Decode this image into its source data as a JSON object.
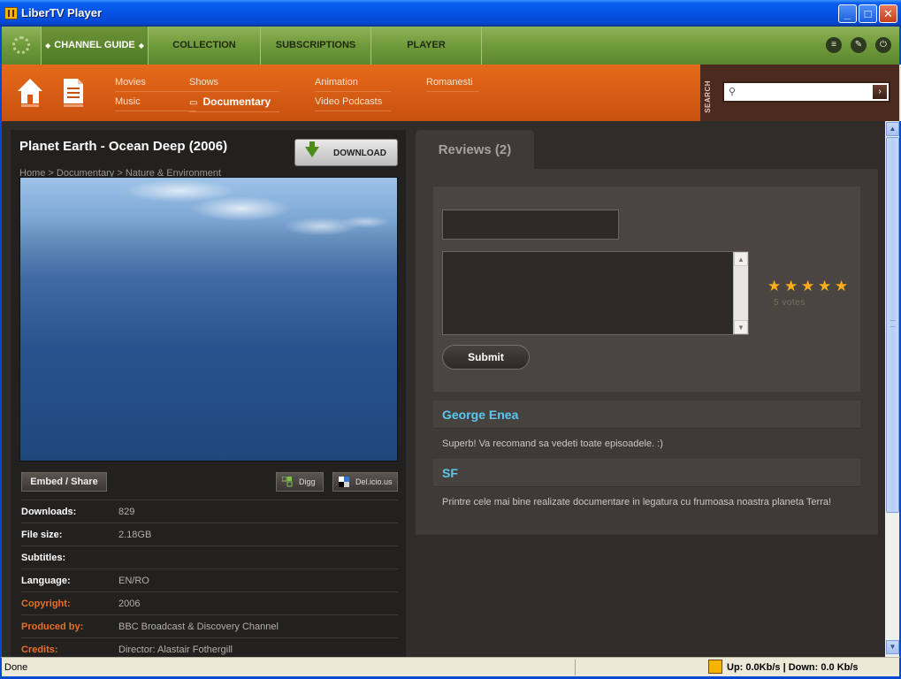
{
  "window": {
    "title": "LiberTV Player",
    "buttons": [
      "_",
      "□",
      "✕"
    ]
  },
  "nav": {
    "tabs": [
      {
        "label": "CHANNEL GUIDE",
        "active": true
      },
      {
        "label": "COLLECTION",
        "active": false
      },
      {
        "label": "SUBSCRIPTIONS",
        "active": false
      },
      {
        "label": "PLAYER",
        "active": false
      }
    ],
    "icons": [
      "list-icon",
      "wrench-icon",
      "power-icon"
    ]
  },
  "categories": [
    {
      "label": "Movies"
    },
    {
      "label": "Music"
    },
    {
      "label": "Shows"
    },
    {
      "label": "Documentary",
      "active": true
    },
    {
      "label": "Animation"
    },
    {
      "label": "Video Podcasts"
    },
    {
      "label": "Romanesti"
    }
  ],
  "search": {
    "label": "SEARCH",
    "placeholder": "",
    "go": "›"
  },
  "item": {
    "title": "Planet Earth - Ocean Deep (2006)",
    "breadcrumb": "Home > Documentary > Nature & Environment",
    "download_label": "DOWNLOAD",
    "embed_label": "Embed / Share",
    "digg_label": "Digg",
    "delicious_label": "Del.icio.us",
    "meta": [
      {
        "key": "Downloads:",
        "value": "829",
        "accent": false
      },
      {
        "key": "File size:",
        "value": "2.18GB",
        "accent": false
      },
      {
        "key": "Subtitles:",
        "value": "",
        "accent": false
      },
      {
        "key": "Language:",
        "value": "EN/RO",
        "accent": false
      },
      {
        "key": "Copyright:",
        "value": "2006",
        "accent": true
      },
      {
        "key": "Produced by:",
        "value": "BBC Broadcast & Discovery Channel",
        "accent": true
      },
      {
        "key": "Credits:",
        "value": "Director: Alastair Fothergill",
        "accent": true
      }
    ]
  },
  "reviews": {
    "tab_label": "Reviews (2)",
    "submit_label": "Submit",
    "rating": {
      "stars": 5,
      "max": 5,
      "votes_label": "5 votes"
    },
    "list": [
      {
        "author": "George Enea",
        "text": "Superb! Va recomand sa vedeti toate episoadele. :)"
      },
      {
        "author": "SF",
        "text": "Printre cele mai bine realizate documentare in legatura cu frumoasa noastra planeta Terra!"
      }
    ]
  },
  "status": {
    "left": "Done",
    "rates": "Up: 0.0Kb/s  |  Down: 0.0 Kb/s"
  },
  "colors": {
    "nav_green": "#6f9a3a",
    "category_orange": "#d85e14",
    "accent_orange": "#e8702a",
    "review_author": "#5bc7f0",
    "star": "#ffae1a"
  }
}
